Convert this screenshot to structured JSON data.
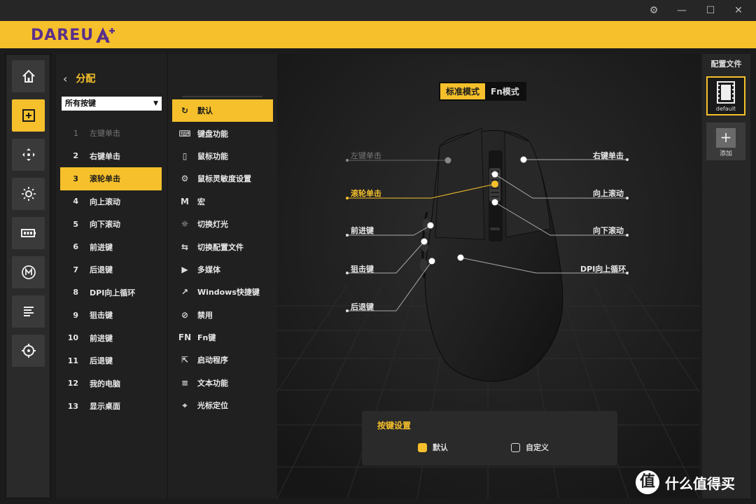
{
  "window": {
    "settings_icon": "gear-icon",
    "min_icon": "minimize-icon",
    "max_icon": "maximize-icon",
    "close_icon": "close-icon"
  },
  "header": {
    "logo_text": "DAREU"
  },
  "sidebar": {
    "items": [
      {
        "icon": "home-icon"
      },
      {
        "icon": "assign-icon",
        "active": true
      },
      {
        "icon": "dpi-icon"
      },
      {
        "icon": "light-icon"
      },
      {
        "icon": "battery-icon"
      },
      {
        "icon": "macro-icon"
      },
      {
        "icon": "text-icon"
      },
      {
        "icon": "crosshair-icon"
      }
    ]
  },
  "assign": {
    "title": "分配",
    "dropdown": "所有按键",
    "keys": [
      {
        "num": "1",
        "label": "左键单击"
      },
      {
        "num": "2",
        "label": "右键单击"
      },
      {
        "num": "3",
        "label": "滚轮单击"
      },
      {
        "num": "4",
        "label": "向上滚动"
      },
      {
        "num": "5",
        "label": "向下滚动"
      },
      {
        "num": "6",
        "label": "前进键"
      },
      {
        "num": "7",
        "label": "后退键"
      },
      {
        "num": "8",
        "label": "DPI向上循环"
      },
      {
        "num": "9",
        "label": "狙击键"
      },
      {
        "num": "10",
        "label": "前进键"
      },
      {
        "num": "11",
        "label": "后退键"
      },
      {
        "num": "12",
        "label": "我的电脑"
      },
      {
        "num": "13",
        "label": "显示桌面"
      }
    ]
  },
  "functions": [
    {
      "icon": "reset-icon",
      "glyph": "↻",
      "label": "默认"
    },
    {
      "icon": "keyboard-icon",
      "glyph": "⌨",
      "label": "键盘功能"
    },
    {
      "icon": "mouse-icon",
      "glyph": "▯",
      "label": "鼠标功能"
    },
    {
      "icon": "sensitivity-icon",
      "glyph": "⚙",
      "label": "鼠标灵敏度设置"
    },
    {
      "icon": "macro-icon",
      "glyph": "M",
      "label": "宏"
    },
    {
      "icon": "light-icon",
      "glyph": "☼",
      "label": "切换灯光"
    },
    {
      "icon": "switch-icon",
      "glyph": "⇆",
      "label": "切换配置文件"
    },
    {
      "icon": "media-icon",
      "glyph": "▶",
      "label": "多媒体"
    },
    {
      "icon": "windows-shortcut-icon",
      "glyph": "↗",
      "label": "Windows快捷键"
    },
    {
      "icon": "disable-icon",
      "glyph": "⊘",
      "label": "禁用"
    },
    {
      "icon": "fn-icon",
      "glyph": "FN",
      "label": "Fn键"
    },
    {
      "icon": "launch-icon",
      "glyph": "⇱",
      "label": "启动程序"
    },
    {
      "icon": "text-icon",
      "glyph": "≡",
      "label": "文本功能"
    },
    {
      "icon": "cursor-locate-icon",
      "glyph": "⌖",
      "label": "光标定位"
    }
  ],
  "stage": {
    "tabs": [
      "标准模式",
      "Fn模式"
    ],
    "callouts": {
      "left_click": "左键单击",
      "middle_click": "滚轮单击",
      "forward": "前进键",
      "sniper": "狙击键",
      "back": "后退键",
      "right_click": "右键单击",
      "scroll_up": "向上滚动",
      "scroll_down": "向下滚动",
      "dpi_up": "DPI向上循环"
    },
    "keyset": {
      "title": "按键设置",
      "default_label": "默认",
      "custom_label": "自定义"
    }
  },
  "profiles": {
    "title": "配置文件",
    "current": "default",
    "add_label": "添加"
  },
  "watermark": {
    "badge": "值",
    "text": "什么值得买"
  },
  "colors": {
    "accent": "#f5c02b",
    "brand": "#5b2f8a"
  }
}
